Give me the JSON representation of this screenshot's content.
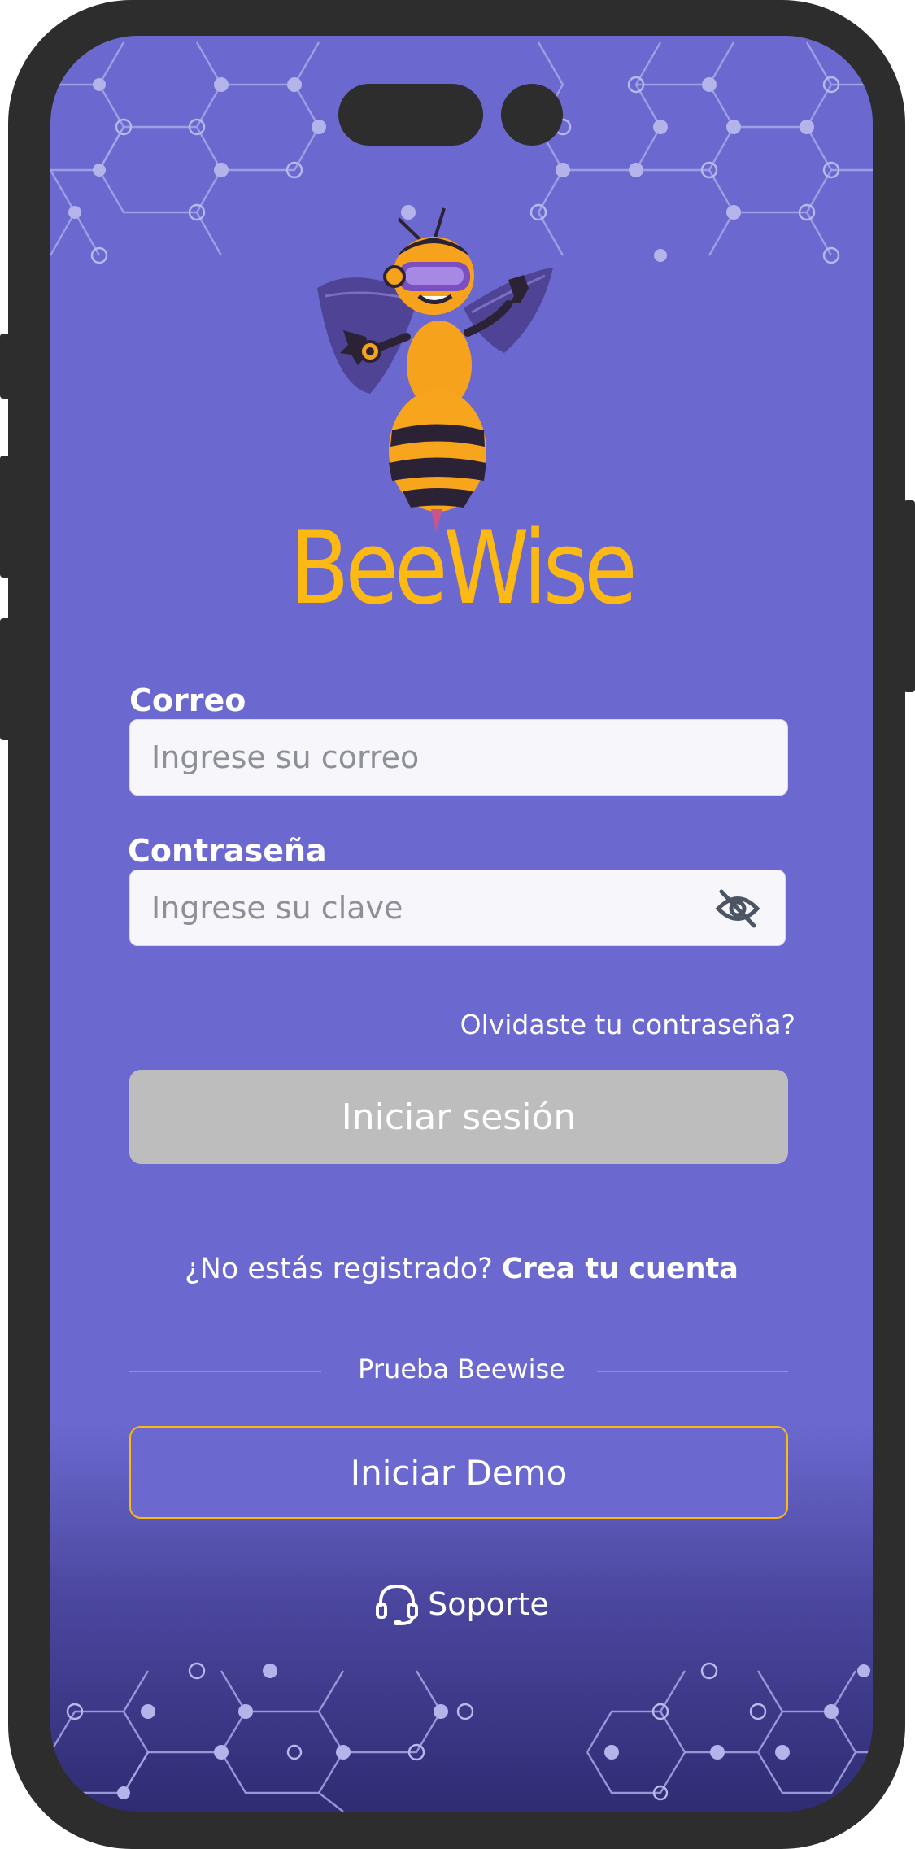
{
  "brand": {
    "name": "BeeWise",
    "color": "#fcb813"
  },
  "colors": {
    "background": "#6b69cf",
    "accent": "#fcb813",
    "disabled_button": "#bdbdbd"
  },
  "form": {
    "email_label": "Correo",
    "email_placeholder": "Ingrese su correo",
    "password_label": "Contraseña",
    "password_placeholder": "Ingrese su clave",
    "password_toggle_icon": "eye-off-icon",
    "forgot_link": "Olvidaste tu contraseña?",
    "login_button": "Iniciar sesión"
  },
  "register": {
    "prompt": "¿No estás registrado?",
    "link": "Crea tu cuenta"
  },
  "demo": {
    "divider_text": "Prueba Beewise",
    "button": "Iniciar Demo"
  },
  "support": {
    "label": "Soporte",
    "icon": "headset-icon"
  }
}
